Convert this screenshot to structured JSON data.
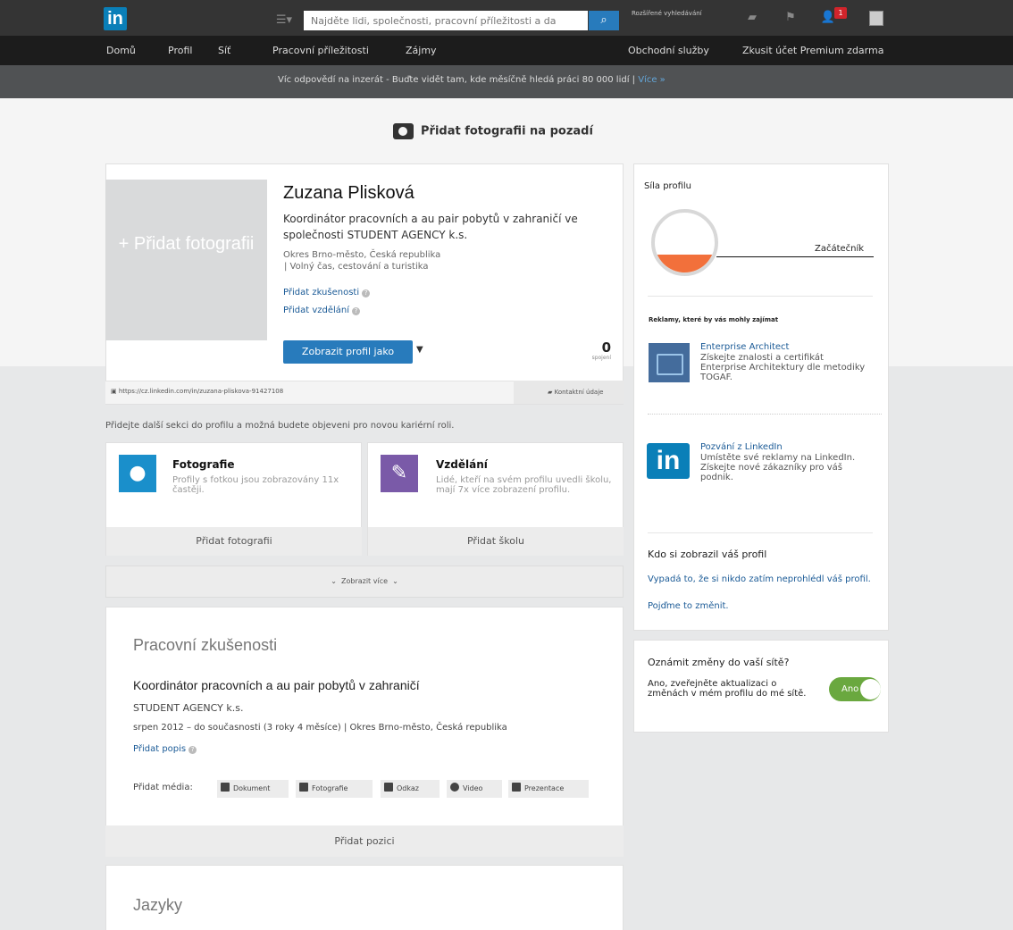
{
  "header": {
    "logo": "in",
    "search_placeholder": "Najděte lidi, společnosti, pracovní příležitosti a da",
    "advanced_search": "Rozšířené vyhledávání",
    "notification_count": "1"
  },
  "nav": {
    "items": [
      "Domů",
      "Profil",
      "Síť",
      "Pracovní příležitosti",
      "Zájmy",
      "Obchodní služby",
      "Zkusit účet Premium zdarma"
    ]
  },
  "banner": {
    "text": "Víc odpovědí na inzerát - Buďte vidět tam, kde měsíčně hledá práci 80 000 lidí",
    "separator": "|",
    "more": "Více »"
  },
  "cover": {
    "add_background": "Přidat fotografii na pozadí"
  },
  "profile": {
    "add_photo_plus": "+",
    "add_photo": "Přidat fotografii",
    "name": "Zuzana Plisková",
    "headline": "Koordinátor pracovních a au pair pobytů v zahraničí ve společnosti STUDENT AGENCY k.s.",
    "location": "Okres Brno-město, Česká republika",
    "industry": "| Volný čas, cestování a turistika",
    "add_experience": "Přidat zkušenosti",
    "add_education": "Přidat vzdělání",
    "view_as": "Zobrazit profil jako",
    "connections": "0",
    "connections_label": "spojení",
    "public_url": "https://cz.linkedin.com/in/zuzana-pliskova-91427108",
    "contact_info": "Kontaktní údaje"
  },
  "sections_prompt": "Přidejte další sekci do profilu a možná budete objeveni pro novou kariérní roli.",
  "tiles": [
    {
      "title": "Fotografie",
      "desc": "Profily s fotkou jsou zobrazovány 11x častěji.",
      "action": "Přidat fotografii",
      "color": "#1a8fcb"
    },
    {
      "title": "Vzdělání",
      "desc": "Lidé, kteří na svém profilu uvedli školu, mají 7x více zobrazení profilu.",
      "action": "Přidat školu",
      "color": "#7a5aa8"
    }
  ],
  "show_more": "Zobrazit více",
  "experience": {
    "section_title": "Pracovní zkušenosti",
    "job_title": "Koordinátor pracovních a au pair pobytů v zahraničí",
    "company": "STUDENT AGENCY k.s.",
    "dates": "srpen 2012 – do současnosti (3 roky 4 měsíce) | Okres Brno-město, Česká republika",
    "add_description": "Přidat popis",
    "media_label": "Přidat média:",
    "media": [
      "Dokument",
      "Fotografie",
      "Odkaz",
      "Video",
      "Prezentace"
    ],
    "add_position": "Přidat pozici"
  },
  "languages": {
    "section_title": "Jazyky"
  },
  "sidebar": {
    "strength_label": "Síla profilu",
    "strength_level": "Začátečník",
    "strength_fraction": 0.3,
    "ads_label": "Reklamy, které by vás mohly zajímat",
    "ad1_title": "Enterprise Architect",
    "ad1_text": "Získejte znalosti a certifikát Enterprise Architektury dle metodiky TOGAF.",
    "ad2_logo": "in",
    "ad2_title": "Pozvání z LinkedIn",
    "ad2_text": "Umístěte své reklamy na LinkedIn. Získejte nové zákazníky pro váš podnik.",
    "viewers_title": "Kdo si zobrazil váš profil",
    "viewers_text": "Vypadá to, že si nikdo zatím neprohlédl váš profil.",
    "viewers_cta": "Pojďme to změnit.",
    "notify_title": "Oznámit změny do vaší sítě?",
    "notify_text": "Ano, zveřejněte aktualizaci o změnách v mém profilu do mé sítě.",
    "toggle_label": "Ano"
  }
}
